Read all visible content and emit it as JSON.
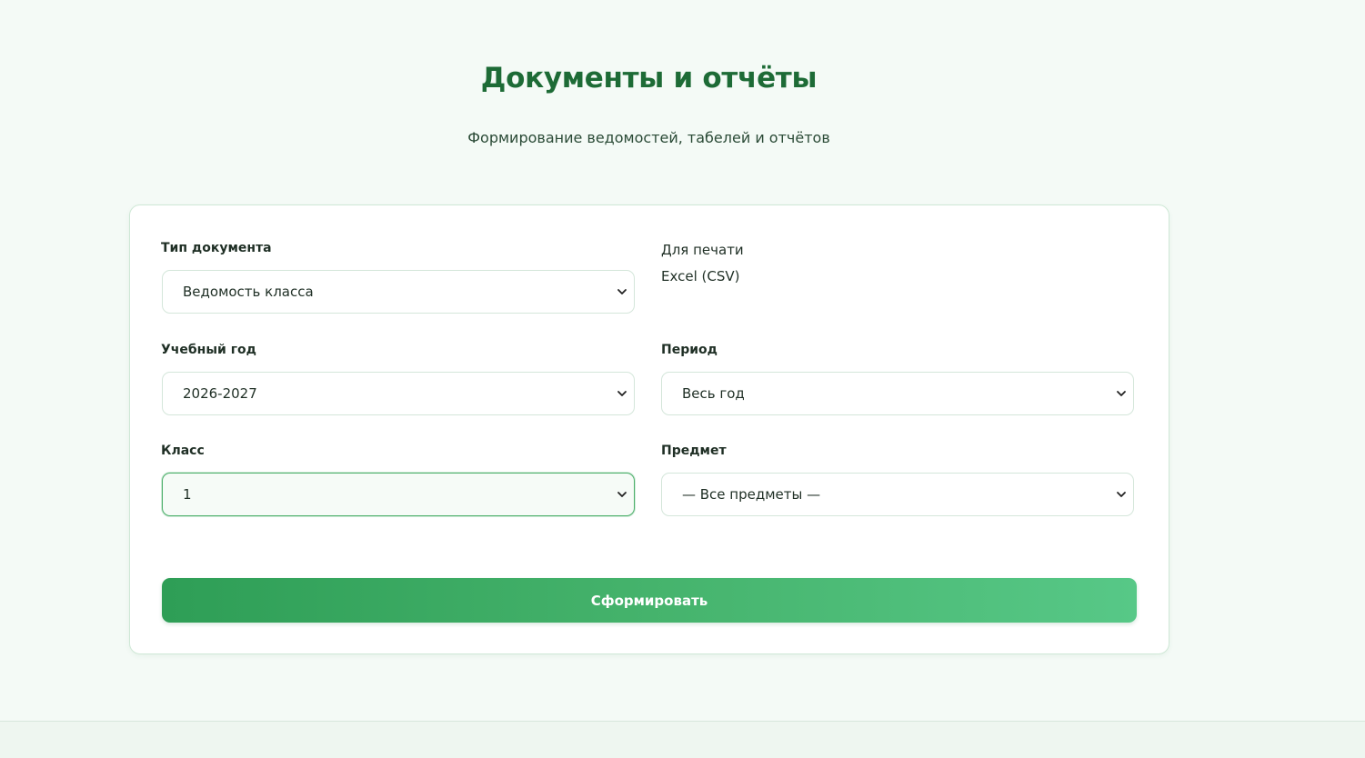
{
  "header": {
    "title": "Документы и отчёты",
    "subtitle": "Формирование ведомостей, табелей и отчётов"
  },
  "form": {
    "doc_type": {
      "label": "Тип документа",
      "value": "Ведомость класса"
    },
    "format": {
      "label": "Для печати",
      "value": "Excel (CSV)"
    },
    "year": {
      "label": "Учебный год",
      "value": "2026-2027"
    },
    "period": {
      "label": "Период",
      "value": "Весь год"
    },
    "class": {
      "label": "Класс",
      "value": "1"
    },
    "subject": {
      "label": "Предмет",
      "value": "— Все предметы —"
    },
    "submit_label": "Сформировать"
  },
  "icons": {
    "dropdown": "chevron-down-icon"
  },
  "colors": {
    "accent": "#2e9e56",
    "title": "#1d6b36",
    "background": "#f4faf6"
  }
}
